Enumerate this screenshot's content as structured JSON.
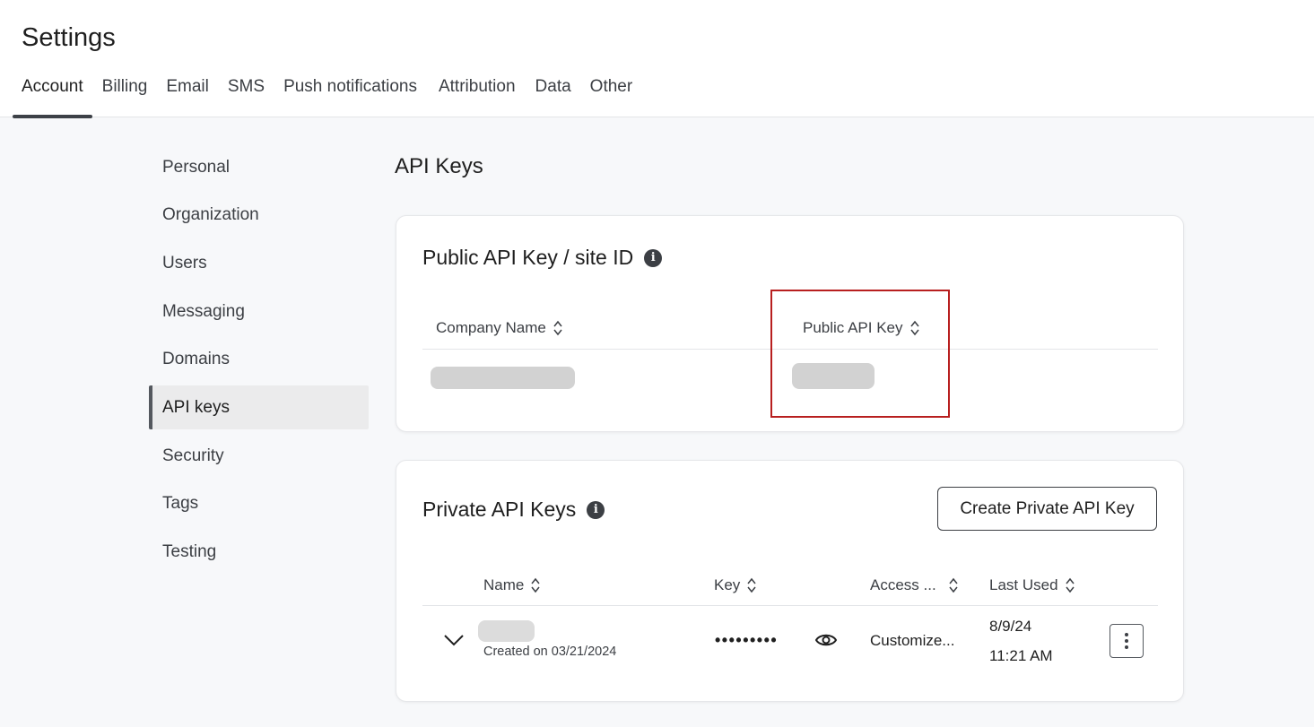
{
  "header": {
    "title": "Settings",
    "tabs": [
      {
        "label": "Account",
        "active": true
      },
      {
        "label": "Billing"
      },
      {
        "label": "Email"
      },
      {
        "label": "SMS"
      },
      {
        "label": "Push notifications"
      },
      {
        "label": "Attribution"
      },
      {
        "label": "Data"
      },
      {
        "label": "Other"
      }
    ]
  },
  "sidebar": {
    "items": [
      {
        "label": "Personal"
      },
      {
        "label": "Organization"
      },
      {
        "label": "Users"
      },
      {
        "label": "Messaging"
      },
      {
        "label": "Domains"
      },
      {
        "label": "API keys",
        "active": true
      },
      {
        "label": "Security"
      },
      {
        "label": "Tags"
      },
      {
        "label": "Testing"
      }
    ]
  },
  "main": {
    "title": "API Keys",
    "public_card": {
      "title": "Public API Key / site ID",
      "columns": [
        "Company Name",
        "Public API Key"
      ],
      "highlight_color": "#b81f1f"
    },
    "private_card": {
      "title": "Private API Keys",
      "create_button": "Create Private API Key",
      "columns": [
        "Name",
        "Key",
        "Access ...",
        "Last Used"
      ],
      "row": {
        "created": "Created on 03/21/2024",
        "key_masked": "•••••••••",
        "access": "Customize...",
        "last_used_date": "8/9/24",
        "last_used_time": "11:21 AM"
      }
    }
  }
}
